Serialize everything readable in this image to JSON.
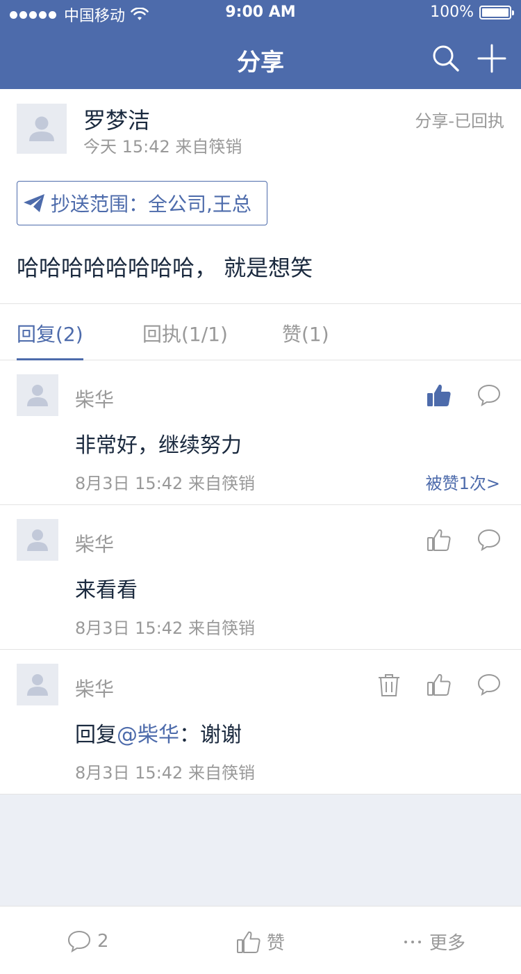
{
  "status_bar": {
    "carrier": "中国移动",
    "time": "9:00 AM",
    "battery": "100%"
  },
  "nav": {
    "title": "分享"
  },
  "post": {
    "author": "罗梦洁",
    "meta": "今天 15:42 来自筷销",
    "status": "分享-已回执",
    "cc": "抄送范围：全公司,王总",
    "body": "哈哈哈哈哈哈哈哈，  就是想笑"
  },
  "tabs": [
    {
      "label": "回复(2)"
    },
    {
      "label": "回执(1/1)"
    },
    {
      "label": "赞(1)"
    }
  ],
  "comments": [
    {
      "name": "柴华",
      "text": "非常好，继续努力",
      "meta": "8月3日 15:42 来自筷销",
      "like_count": "被赞1次>"
    },
    {
      "name": "柴华",
      "text": "来看看",
      "meta": "8月3日 15:42 来自筷销"
    },
    {
      "name": "柴华",
      "text_prefix": "回复",
      "mention": "@柴华",
      "text_suffix": "：谢谢",
      "meta": "8月3日 15:42 来自筷销"
    }
  ],
  "bottom_bar": {
    "comment_count": "2",
    "like_label": "赞",
    "more_label": "更多"
  },
  "colors": {
    "brand": "#4D6BAB",
    "text_primary": "#1A293E",
    "text_secondary": "#999999"
  }
}
